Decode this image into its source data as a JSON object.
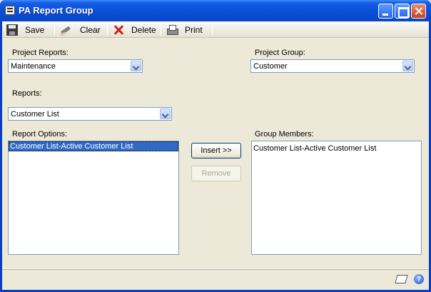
{
  "window": {
    "title": "PA Report Group"
  },
  "toolbar": {
    "save_label": "Save",
    "clear_label": "Clear",
    "delete_label": "Delete",
    "print_label": "Print"
  },
  "form": {
    "project_reports_label": "Project Reports:",
    "project_reports_value": "Maintenance",
    "project_group_label": "Project Group:",
    "project_group_value": "Customer",
    "reports_label": "Reports:",
    "reports_value": "Customer List",
    "report_options_label": "Report Options:",
    "report_options_items": [
      "Customer List-Active Customer List"
    ],
    "group_members_label": "Group Members:",
    "group_members_items": [
      "Customer List-Active Customer List"
    ],
    "insert_label": "Insert >>",
    "remove_label": "Remove"
  },
  "icons": {
    "save": "save-icon",
    "clear": "eraser-icon",
    "delete": "delete-x-icon",
    "print": "printer-icon",
    "note": "note-icon",
    "help": "help-icon"
  },
  "colors": {
    "titlebar": "#0b53dd",
    "selection": "#316ac5",
    "background": "#ece9d8"
  }
}
